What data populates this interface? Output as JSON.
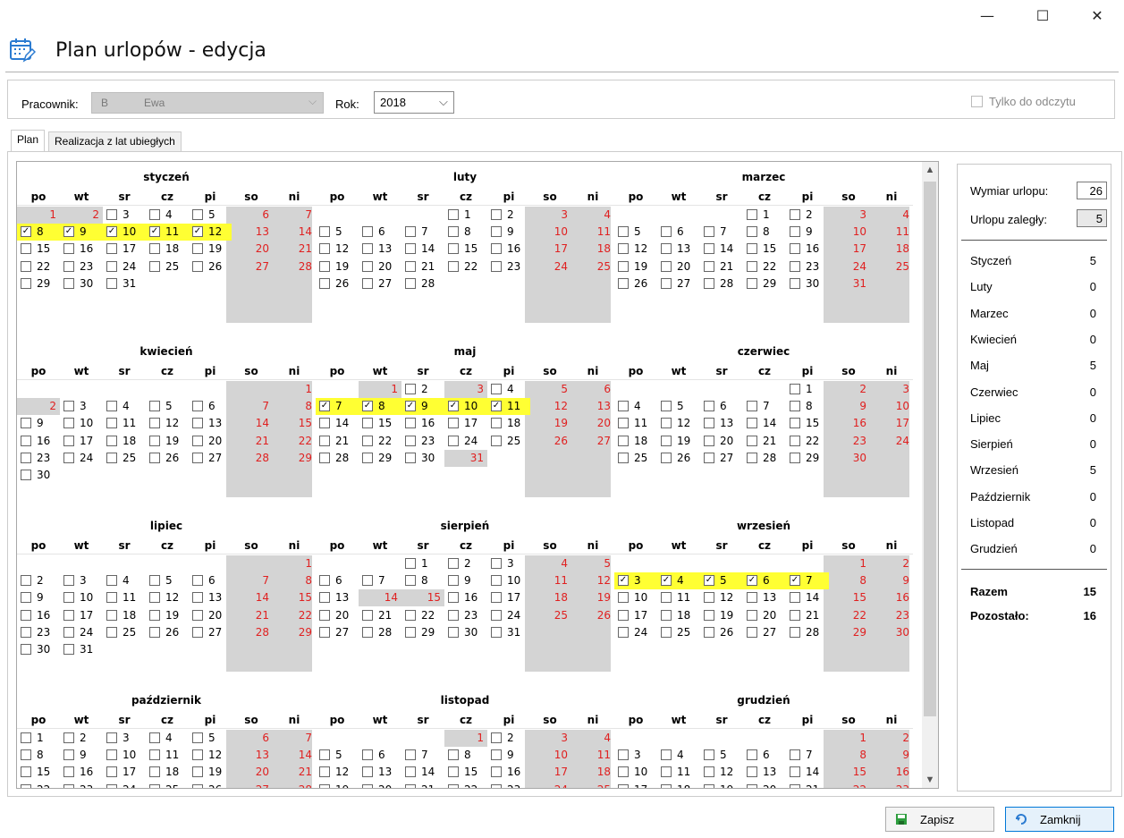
{
  "window": {
    "minimize": "—",
    "maximize": "☐",
    "close": "✕"
  },
  "title": "Plan urlopów - edycja",
  "filters": {
    "employee_label": "Pracownik:",
    "employee_initial": "B",
    "employee_name": "Ewa",
    "year_label": "Rok:",
    "year_value": "2018",
    "readonly_label": "Tylko do odczytu"
  },
  "tabs": [
    {
      "label": "Plan"
    },
    {
      "label": "Realizacja z lat ubiegłych"
    }
  ],
  "weekdays": [
    "po",
    "wt",
    "sr",
    "cz",
    "pi",
    "so",
    "ni"
  ],
  "months": [
    {
      "name": "styczeń",
      "start": 0,
      "days": 31,
      "checked": [
        8,
        9,
        10,
        11,
        12
      ],
      "holidays": [
        1,
        2
      ]
    },
    {
      "name": "luty",
      "start": 3,
      "days": 28,
      "checked": [],
      "holidays": []
    },
    {
      "name": "marzec",
      "start": 3,
      "days": 31,
      "checked": [],
      "holidays": []
    },
    {
      "name": "kwiecień",
      "start": 6,
      "days": 30,
      "checked": [],
      "holidays": [
        2
      ]
    },
    {
      "name": "maj",
      "start": 1,
      "days": 31,
      "checked": [
        7,
        8,
        9,
        10,
        11
      ],
      "holidays": [
        1,
        3,
        31
      ]
    },
    {
      "name": "czerwiec",
      "start": 4,
      "days": 30,
      "checked": [],
      "holidays": []
    },
    {
      "name": "lipiec",
      "start": 6,
      "days": 31,
      "checked": [],
      "holidays": []
    },
    {
      "name": "sierpień",
      "start": 2,
      "days": 31,
      "checked": [],
      "holidays": [
        14,
        15
      ]
    },
    {
      "name": "wrzesień",
      "start": 5,
      "days": 30,
      "checked": [
        3,
        4,
        5,
        6,
        7
      ],
      "holidays": []
    },
    {
      "name": "październik",
      "start": 0,
      "days": 31,
      "checked": [],
      "holidays": []
    },
    {
      "name": "listopad",
      "start": 3,
      "days": 30,
      "checked": [],
      "holidays": [
        1
      ]
    },
    {
      "name": "grudzień",
      "start": 5,
      "days": 31,
      "checked": [],
      "holidays": []
    }
  ],
  "summary": {
    "allowance_label": "Wymiar urlopu:",
    "allowance": "26",
    "overdue_label": "Urlopu zaległy:",
    "overdue": "5",
    "months": [
      {
        "label": "Styczeń",
        "value": "5"
      },
      {
        "label": "Luty",
        "value": "0"
      },
      {
        "label": "Marzec",
        "value": "0"
      },
      {
        "label": "Kwiecień",
        "value": "0"
      },
      {
        "label": "Maj",
        "value": "5"
      },
      {
        "label": "Czerwiec",
        "value": "0"
      },
      {
        "label": "Lipiec",
        "value": "0"
      },
      {
        "label": "Sierpień",
        "value": "0"
      },
      {
        "label": "Wrzesień",
        "value": "5"
      },
      {
        "label": "Październik",
        "value": "0"
      },
      {
        "label": "Listopad",
        "value": "0"
      },
      {
        "label": "Grudzień",
        "value": "0"
      }
    ],
    "total_label": "Razem",
    "total": "15",
    "remaining_label": "Pozostało:",
    "remaining": "16"
  },
  "buttons": {
    "save": "Zapisz",
    "close": "Zamknij"
  },
  "colors": {
    "highlight": "#ffff33",
    "weekend": "#d4d4d4",
    "weekend_text": "#e02020",
    "accent": "#0078d7"
  }
}
